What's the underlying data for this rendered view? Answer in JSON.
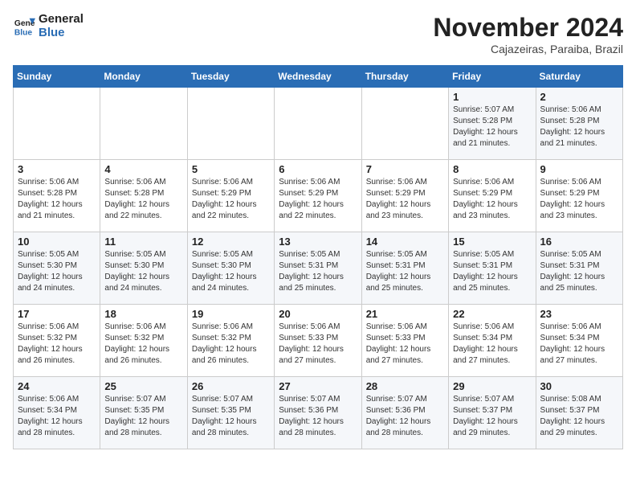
{
  "logo": {
    "line1": "General",
    "line2": "Blue"
  },
  "title": "November 2024",
  "location": "Cajazeiras, Paraiba, Brazil",
  "weekdays": [
    "Sunday",
    "Monday",
    "Tuesday",
    "Wednesday",
    "Thursday",
    "Friday",
    "Saturday"
  ],
  "weeks": [
    [
      {
        "day": "",
        "info": ""
      },
      {
        "day": "",
        "info": ""
      },
      {
        "day": "",
        "info": ""
      },
      {
        "day": "",
        "info": ""
      },
      {
        "day": "",
        "info": ""
      },
      {
        "day": "1",
        "info": "Sunrise: 5:07 AM\nSunset: 5:28 PM\nDaylight: 12 hours\nand 21 minutes."
      },
      {
        "day": "2",
        "info": "Sunrise: 5:06 AM\nSunset: 5:28 PM\nDaylight: 12 hours\nand 21 minutes."
      }
    ],
    [
      {
        "day": "3",
        "info": "Sunrise: 5:06 AM\nSunset: 5:28 PM\nDaylight: 12 hours\nand 21 minutes."
      },
      {
        "day": "4",
        "info": "Sunrise: 5:06 AM\nSunset: 5:28 PM\nDaylight: 12 hours\nand 22 minutes."
      },
      {
        "day": "5",
        "info": "Sunrise: 5:06 AM\nSunset: 5:29 PM\nDaylight: 12 hours\nand 22 minutes."
      },
      {
        "day": "6",
        "info": "Sunrise: 5:06 AM\nSunset: 5:29 PM\nDaylight: 12 hours\nand 22 minutes."
      },
      {
        "day": "7",
        "info": "Sunrise: 5:06 AM\nSunset: 5:29 PM\nDaylight: 12 hours\nand 23 minutes."
      },
      {
        "day": "8",
        "info": "Sunrise: 5:06 AM\nSunset: 5:29 PM\nDaylight: 12 hours\nand 23 minutes."
      },
      {
        "day": "9",
        "info": "Sunrise: 5:06 AM\nSunset: 5:29 PM\nDaylight: 12 hours\nand 23 minutes."
      }
    ],
    [
      {
        "day": "10",
        "info": "Sunrise: 5:05 AM\nSunset: 5:30 PM\nDaylight: 12 hours\nand 24 minutes."
      },
      {
        "day": "11",
        "info": "Sunrise: 5:05 AM\nSunset: 5:30 PM\nDaylight: 12 hours\nand 24 minutes."
      },
      {
        "day": "12",
        "info": "Sunrise: 5:05 AM\nSunset: 5:30 PM\nDaylight: 12 hours\nand 24 minutes."
      },
      {
        "day": "13",
        "info": "Sunrise: 5:05 AM\nSunset: 5:31 PM\nDaylight: 12 hours\nand 25 minutes."
      },
      {
        "day": "14",
        "info": "Sunrise: 5:05 AM\nSunset: 5:31 PM\nDaylight: 12 hours\nand 25 minutes."
      },
      {
        "day": "15",
        "info": "Sunrise: 5:05 AM\nSunset: 5:31 PM\nDaylight: 12 hours\nand 25 minutes."
      },
      {
        "day": "16",
        "info": "Sunrise: 5:05 AM\nSunset: 5:31 PM\nDaylight: 12 hours\nand 25 minutes."
      }
    ],
    [
      {
        "day": "17",
        "info": "Sunrise: 5:06 AM\nSunset: 5:32 PM\nDaylight: 12 hours\nand 26 minutes."
      },
      {
        "day": "18",
        "info": "Sunrise: 5:06 AM\nSunset: 5:32 PM\nDaylight: 12 hours\nand 26 minutes."
      },
      {
        "day": "19",
        "info": "Sunrise: 5:06 AM\nSunset: 5:32 PM\nDaylight: 12 hours\nand 26 minutes."
      },
      {
        "day": "20",
        "info": "Sunrise: 5:06 AM\nSunset: 5:33 PM\nDaylight: 12 hours\nand 27 minutes."
      },
      {
        "day": "21",
        "info": "Sunrise: 5:06 AM\nSunset: 5:33 PM\nDaylight: 12 hours\nand 27 minutes."
      },
      {
        "day": "22",
        "info": "Sunrise: 5:06 AM\nSunset: 5:34 PM\nDaylight: 12 hours\nand 27 minutes."
      },
      {
        "day": "23",
        "info": "Sunrise: 5:06 AM\nSunset: 5:34 PM\nDaylight: 12 hours\nand 27 minutes."
      }
    ],
    [
      {
        "day": "24",
        "info": "Sunrise: 5:06 AM\nSunset: 5:34 PM\nDaylight: 12 hours\nand 28 minutes."
      },
      {
        "day": "25",
        "info": "Sunrise: 5:07 AM\nSunset: 5:35 PM\nDaylight: 12 hours\nand 28 minutes."
      },
      {
        "day": "26",
        "info": "Sunrise: 5:07 AM\nSunset: 5:35 PM\nDaylight: 12 hours\nand 28 minutes."
      },
      {
        "day": "27",
        "info": "Sunrise: 5:07 AM\nSunset: 5:36 PM\nDaylight: 12 hours\nand 28 minutes."
      },
      {
        "day": "28",
        "info": "Sunrise: 5:07 AM\nSunset: 5:36 PM\nDaylight: 12 hours\nand 28 minutes."
      },
      {
        "day": "29",
        "info": "Sunrise: 5:07 AM\nSunset: 5:37 PM\nDaylight: 12 hours\nand 29 minutes."
      },
      {
        "day": "30",
        "info": "Sunrise: 5:08 AM\nSunset: 5:37 PM\nDaylight: 12 hours\nand 29 minutes."
      }
    ]
  ]
}
